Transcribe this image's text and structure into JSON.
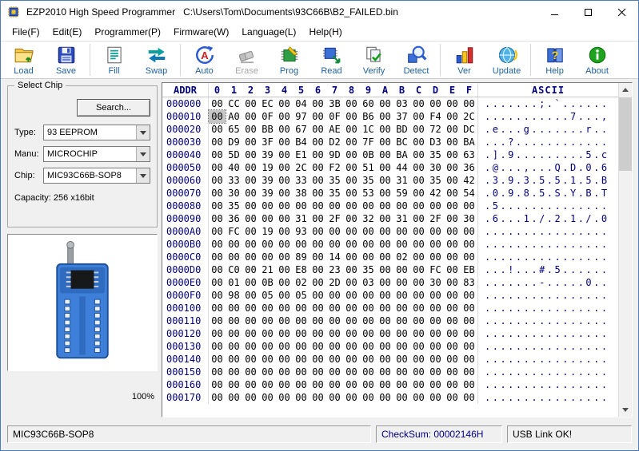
{
  "window": {
    "title": "EZP2010 High Speed Programmer   C:\\Users\\Tom\\Documents\\93C66B\\B2_FAILED.bin"
  },
  "menu": {
    "items": [
      "File(F)",
      "Edit(E)",
      "Programmer(P)",
      "Firmware(W)",
      "Language(L)",
      "Help(H)"
    ]
  },
  "toolbar": {
    "groups": [
      [
        {
          "label": "Load",
          "icon": "load-icon"
        },
        {
          "label": "Save",
          "icon": "save-icon"
        }
      ],
      [
        {
          "label": "Fill",
          "icon": "fill-icon"
        },
        {
          "label": "Swap",
          "icon": "swap-icon"
        }
      ],
      [
        {
          "label": "Auto",
          "icon": "auto-icon"
        },
        {
          "label": "Erase",
          "icon": "erase-icon",
          "enabled": false
        },
        {
          "label": "Prog",
          "icon": "prog-icon"
        },
        {
          "label": "Read",
          "icon": "read-icon"
        },
        {
          "label": "Verify",
          "icon": "verify-icon"
        },
        {
          "label": "Detect",
          "icon": "detect-icon"
        }
      ],
      [
        {
          "label": "Ver",
          "icon": "ver-icon"
        },
        {
          "label": "Update",
          "icon": "update-icon"
        }
      ],
      [
        {
          "label": "Help",
          "icon": "help-icon"
        },
        {
          "label": "About",
          "icon": "about-icon"
        }
      ]
    ]
  },
  "select_chip": {
    "title": "Select Chip",
    "search_label": "Search...",
    "fields": [
      {
        "label": "Type:",
        "value": "93 EEPROM"
      },
      {
        "label": "Manu:",
        "value": "MICROCHIP"
      },
      {
        "label": "Chip:",
        "value": "MIC93C66B-SOP8"
      }
    ],
    "capacity": "Capacity: 256 x16bit",
    "progress": "100%"
  },
  "hex_view": {
    "addr_header": "ADDR",
    "col_headers": [
      "0",
      "1",
      "2",
      "3",
      "4",
      "5",
      "6",
      "7",
      "8",
      "9",
      "A",
      "B",
      "C",
      "D",
      "E",
      "F"
    ],
    "ascii_header": "ASCII",
    "selection": {
      "row_index": 1,
      "byte_index": 0
    },
    "rows": [
      {
        "addr": "000000",
        "bytes": [
          "00",
          "CC",
          "00",
          "EC",
          "00",
          "04",
          "00",
          "3B",
          "00",
          "60",
          "00",
          "03",
          "00",
          "00",
          "00",
          "00"
        ]
      },
      {
        "addr": "000010",
        "bytes": [
          "00",
          "A0",
          "00",
          "0F",
          "00",
          "97",
          "00",
          "0F",
          "00",
          "B6",
          "00",
          "37",
          "00",
          "F4",
          "00",
          "2C"
        ]
      },
      {
        "addr": "000020",
        "bytes": [
          "00",
          "65",
          "00",
          "BB",
          "00",
          "67",
          "00",
          "AE",
          "00",
          "1C",
          "00",
          "BD",
          "00",
          "72",
          "00",
          "DC"
        ]
      },
      {
        "addr": "000030",
        "bytes": [
          "00",
          "D9",
          "00",
          "3F",
          "00",
          "B4",
          "00",
          "D2",
          "00",
          "7F",
          "00",
          "BC",
          "00",
          "D3",
          "00",
          "BA"
        ]
      },
      {
        "addr": "000040",
        "bytes": [
          "00",
          "5D",
          "00",
          "39",
          "00",
          "E1",
          "00",
          "9D",
          "00",
          "0B",
          "00",
          "BA",
          "00",
          "35",
          "00",
          "63"
        ]
      },
      {
        "addr": "000050",
        "bytes": [
          "00",
          "40",
          "00",
          "19",
          "00",
          "2C",
          "00",
          "F2",
          "00",
          "51",
          "00",
          "44",
          "00",
          "30",
          "00",
          "36"
        ]
      },
      {
        "addr": "000060",
        "bytes": [
          "00",
          "33",
          "00",
          "39",
          "00",
          "33",
          "00",
          "35",
          "00",
          "35",
          "00",
          "31",
          "00",
          "35",
          "00",
          "42"
        ]
      },
      {
        "addr": "000070",
        "bytes": [
          "00",
          "30",
          "00",
          "39",
          "00",
          "38",
          "00",
          "35",
          "00",
          "53",
          "00",
          "59",
          "00",
          "42",
          "00",
          "54"
        ]
      },
      {
        "addr": "000080",
        "bytes": [
          "00",
          "35",
          "00",
          "00",
          "00",
          "00",
          "00",
          "00",
          "00",
          "00",
          "00",
          "00",
          "00",
          "00",
          "00",
          "00"
        ]
      },
      {
        "addr": "000090",
        "bytes": [
          "00",
          "36",
          "00",
          "00",
          "00",
          "31",
          "00",
          "2F",
          "00",
          "32",
          "00",
          "31",
          "00",
          "2F",
          "00",
          "30"
        ]
      },
      {
        "addr": "0000A0",
        "bytes": [
          "00",
          "FC",
          "00",
          "19",
          "00",
          "93",
          "00",
          "00",
          "00",
          "00",
          "00",
          "00",
          "00",
          "00",
          "00",
          "00"
        ]
      },
      {
        "addr": "0000B0",
        "bytes": [
          "00",
          "00",
          "00",
          "00",
          "00",
          "00",
          "00",
          "00",
          "00",
          "00",
          "00",
          "00",
          "00",
          "00",
          "00",
          "00"
        ]
      },
      {
        "addr": "0000C0",
        "bytes": [
          "00",
          "00",
          "00",
          "00",
          "00",
          "89",
          "00",
          "14",
          "00",
          "00",
          "00",
          "02",
          "00",
          "00",
          "00",
          "00"
        ]
      },
      {
        "addr": "0000D0",
        "bytes": [
          "00",
          "C0",
          "00",
          "21",
          "00",
          "E8",
          "00",
          "23",
          "00",
          "35",
          "00",
          "00",
          "00",
          "FC",
          "00",
          "EB"
        ]
      },
      {
        "addr": "0000E0",
        "bytes": [
          "00",
          "01",
          "00",
          "0B",
          "00",
          "02",
          "00",
          "2D",
          "00",
          "03",
          "00",
          "00",
          "00",
          "30",
          "00",
          "83"
        ]
      },
      {
        "addr": "0000F0",
        "bytes": [
          "00",
          "98",
          "00",
          "05",
          "00",
          "05",
          "00",
          "00",
          "00",
          "00",
          "00",
          "00",
          "00",
          "00",
          "00",
          "00"
        ]
      },
      {
        "addr": "000100",
        "bytes": [
          "00",
          "00",
          "00",
          "00",
          "00",
          "00",
          "00",
          "00",
          "00",
          "00",
          "00",
          "00",
          "00",
          "00",
          "00",
          "00"
        ]
      },
      {
        "addr": "000110",
        "bytes": [
          "00",
          "00",
          "00",
          "00",
          "00",
          "00",
          "00",
          "00",
          "00",
          "00",
          "00",
          "00",
          "00",
          "00",
          "00",
          "00"
        ]
      },
      {
        "addr": "000120",
        "bytes": [
          "00",
          "00",
          "00",
          "00",
          "00",
          "00",
          "00",
          "00",
          "00",
          "00",
          "00",
          "00",
          "00",
          "00",
          "00",
          "00"
        ]
      },
      {
        "addr": "000130",
        "bytes": [
          "00",
          "00",
          "00",
          "00",
          "00",
          "00",
          "00",
          "00",
          "00",
          "00",
          "00",
          "00",
          "00",
          "00",
          "00",
          "00"
        ]
      },
      {
        "addr": "000140",
        "bytes": [
          "00",
          "00",
          "00",
          "00",
          "00",
          "00",
          "00",
          "00",
          "00",
          "00",
          "00",
          "00",
          "00",
          "00",
          "00",
          "00"
        ]
      },
      {
        "addr": "000150",
        "bytes": [
          "00",
          "00",
          "00",
          "00",
          "00",
          "00",
          "00",
          "00",
          "00",
          "00",
          "00",
          "00",
          "00",
          "00",
          "00",
          "00"
        ]
      },
      {
        "addr": "000160",
        "bytes": [
          "00",
          "00",
          "00",
          "00",
          "00",
          "00",
          "00",
          "00",
          "00",
          "00",
          "00",
          "00",
          "00",
          "00",
          "00",
          "00"
        ]
      },
      {
        "addr": "000170",
        "bytes": [
          "00",
          "00",
          "00",
          "00",
          "00",
          "00",
          "00",
          "00",
          "00",
          "00",
          "00",
          "00",
          "00",
          "00",
          "00",
          "00"
        ]
      }
    ]
  },
  "status_bar": {
    "chip": "MIC93C66B-SOP8",
    "checksum": "CheckSum: 00002146H",
    "usb": "USB Link OK!"
  },
  "colors": {
    "hex_header_text": "#000080",
    "toolbar_label": "#21629e",
    "disabled_text": "#a6a6a6",
    "socket_blue": "#3d7fd9"
  }
}
